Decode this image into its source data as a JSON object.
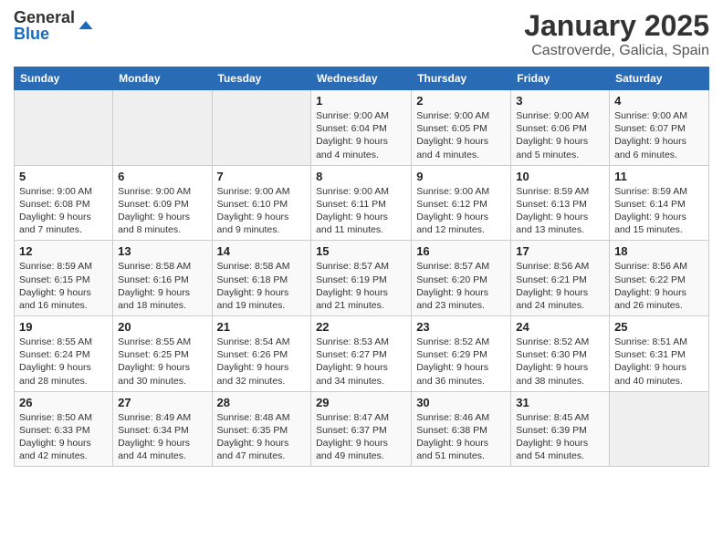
{
  "header": {
    "logo_general": "General",
    "logo_blue": "Blue",
    "title": "January 2025",
    "subtitle": "Castroverde, Galicia, Spain"
  },
  "weekdays": [
    "Sunday",
    "Monday",
    "Tuesday",
    "Wednesday",
    "Thursday",
    "Friday",
    "Saturday"
  ],
  "weeks": [
    [
      {
        "day": "",
        "info": ""
      },
      {
        "day": "",
        "info": ""
      },
      {
        "day": "",
        "info": ""
      },
      {
        "day": "1",
        "info": "Sunrise: 9:00 AM\nSunset: 6:04 PM\nDaylight: 9 hours and 4 minutes."
      },
      {
        "day": "2",
        "info": "Sunrise: 9:00 AM\nSunset: 6:05 PM\nDaylight: 9 hours and 4 minutes."
      },
      {
        "day": "3",
        "info": "Sunrise: 9:00 AM\nSunset: 6:06 PM\nDaylight: 9 hours and 5 minutes."
      },
      {
        "day": "4",
        "info": "Sunrise: 9:00 AM\nSunset: 6:07 PM\nDaylight: 9 hours and 6 minutes."
      }
    ],
    [
      {
        "day": "5",
        "info": "Sunrise: 9:00 AM\nSunset: 6:08 PM\nDaylight: 9 hours and 7 minutes."
      },
      {
        "day": "6",
        "info": "Sunrise: 9:00 AM\nSunset: 6:09 PM\nDaylight: 9 hours and 8 minutes."
      },
      {
        "day": "7",
        "info": "Sunrise: 9:00 AM\nSunset: 6:10 PM\nDaylight: 9 hours and 9 minutes."
      },
      {
        "day": "8",
        "info": "Sunrise: 9:00 AM\nSunset: 6:11 PM\nDaylight: 9 hours and 11 minutes."
      },
      {
        "day": "9",
        "info": "Sunrise: 9:00 AM\nSunset: 6:12 PM\nDaylight: 9 hours and 12 minutes."
      },
      {
        "day": "10",
        "info": "Sunrise: 8:59 AM\nSunset: 6:13 PM\nDaylight: 9 hours and 13 minutes."
      },
      {
        "day": "11",
        "info": "Sunrise: 8:59 AM\nSunset: 6:14 PM\nDaylight: 9 hours and 15 minutes."
      }
    ],
    [
      {
        "day": "12",
        "info": "Sunrise: 8:59 AM\nSunset: 6:15 PM\nDaylight: 9 hours and 16 minutes."
      },
      {
        "day": "13",
        "info": "Sunrise: 8:58 AM\nSunset: 6:16 PM\nDaylight: 9 hours and 18 minutes."
      },
      {
        "day": "14",
        "info": "Sunrise: 8:58 AM\nSunset: 6:18 PM\nDaylight: 9 hours and 19 minutes."
      },
      {
        "day": "15",
        "info": "Sunrise: 8:57 AM\nSunset: 6:19 PM\nDaylight: 9 hours and 21 minutes."
      },
      {
        "day": "16",
        "info": "Sunrise: 8:57 AM\nSunset: 6:20 PM\nDaylight: 9 hours and 23 minutes."
      },
      {
        "day": "17",
        "info": "Sunrise: 8:56 AM\nSunset: 6:21 PM\nDaylight: 9 hours and 24 minutes."
      },
      {
        "day": "18",
        "info": "Sunrise: 8:56 AM\nSunset: 6:22 PM\nDaylight: 9 hours and 26 minutes."
      }
    ],
    [
      {
        "day": "19",
        "info": "Sunrise: 8:55 AM\nSunset: 6:24 PM\nDaylight: 9 hours and 28 minutes."
      },
      {
        "day": "20",
        "info": "Sunrise: 8:55 AM\nSunset: 6:25 PM\nDaylight: 9 hours and 30 minutes."
      },
      {
        "day": "21",
        "info": "Sunrise: 8:54 AM\nSunset: 6:26 PM\nDaylight: 9 hours and 32 minutes."
      },
      {
        "day": "22",
        "info": "Sunrise: 8:53 AM\nSunset: 6:27 PM\nDaylight: 9 hours and 34 minutes."
      },
      {
        "day": "23",
        "info": "Sunrise: 8:52 AM\nSunset: 6:29 PM\nDaylight: 9 hours and 36 minutes."
      },
      {
        "day": "24",
        "info": "Sunrise: 8:52 AM\nSunset: 6:30 PM\nDaylight: 9 hours and 38 minutes."
      },
      {
        "day": "25",
        "info": "Sunrise: 8:51 AM\nSunset: 6:31 PM\nDaylight: 9 hours and 40 minutes."
      }
    ],
    [
      {
        "day": "26",
        "info": "Sunrise: 8:50 AM\nSunset: 6:33 PM\nDaylight: 9 hours and 42 minutes."
      },
      {
        "day": "27",
        "info": "Sunrise: 8:49 AM\nSunset: 6:34 PM\nDaylight: 9 hours and 44 minutes."
      },
      {
        "day": "28",
        "info": "Sunrise: 8:48 AM\nSunset: 6:35 PM\nDaylight: 9 hours and 47 minutes."
      },
      {
        "day": "29",
        "info": "Sunrise: 8:47 AM\nSunset: 6:37 PM\nDaylight: 9 hours and 49 minutes."
      },
      {
        "day": "30",
        "info": "Sunrise: 8:46 AM\nSunset: 6:38 PM\nDaylight: 9 hours and 51 minutes."
      },
      {
        "day": "31",
        "info": "Sunrise: 8:45 AM\nSunset: 6:39 PM\nDaylight: 9 hours and 54 minutes."
      },
      {
        "day": "",
        "info": ""
      }
    ]
  ]
}
